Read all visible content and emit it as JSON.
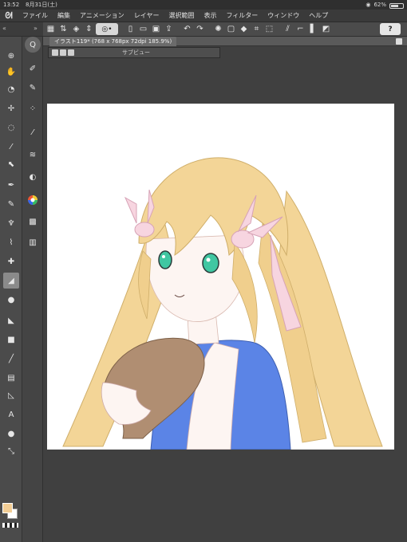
{
  "status_bar": {
    "time": "13:52",
    "date": "8月31日(土)",
    "battery": "62%"
  },
  "menu": {
    "items": [
      "ファイル",
      "編集",
      "アニメーション",
      "レイヤー",
      "選択範囲",
      "表示",
      "フィルター",
      "ウィンドウ",
      "ヘルプ"
    ]
  },
  "command_bar": {
    "help_label": "?"
  },
  "document": {
    "tab_title": "イラスト119* (768 x 768px 72dpi 185.9%)"
  },
  "subview": {
    "title": "サブビュー"
  },
  "colors": {
    "main_color": "#f2cd95",
    "sub_color": "#ffffff",
    "hair": "#f3d597",
    "dress": "#5b84e6",
    "ribbon": "#f7d5e0",
    "eyes": "#40c7a2",
    "hat": "#b08e72",
    "skin": "#fdf5f2"
  },
  "icons": {
    "app": "clip-studio-icon",
    "tools": [
      "zoom-icon",
      "hand-icon",
      "rotate-icon",
      "move-icon",
      "lasso-icon",
      "eyedropper-icon",
      "object-icon",
      "pen-icon",
      "pencil-icon",
      "brush-icon",
      "airbrush-icon",
      "decoration-icon",
      "eraser-icon",
      "blend-icon",
      "fill-icon",
      "gradient-icon",
      "figure-icon",
      "frame-icon",
      "ruler-icon",
      "text-icon",
      "balloon-icon",
      "correction-line-icon"
    ]
  }
}
